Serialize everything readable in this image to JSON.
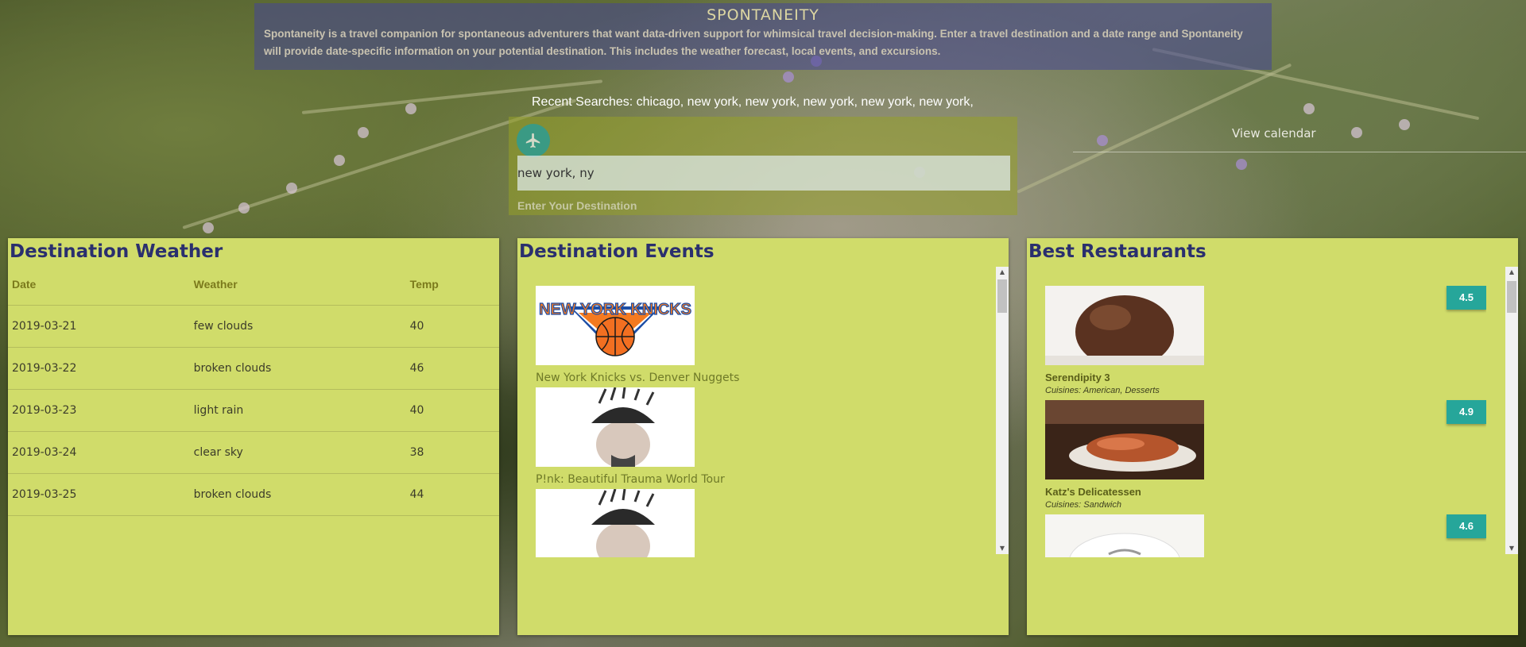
{
  "app": {
    "title": "SPONTANEITY",
    "description": "Spontaneity is a travel companion for spontaneous adventurers that want data-driven support for whimsical travel decision-making. Enter a travel destination and a date range and Spontaneity will provide date-specific information on your potential destination. This includes the weather forecast, local events, and excursions."
  },
  "search": {
    "recent_label": "Recent Searches:",
    "recent_list": "chicago, new york, new york, new york, new york, new york,",
    "input_value": "new york, ny",
    "input_label": "Enter Your Destination",
    "plane_icon": "airplane-icon",
    "view_calendar": "View calendar"
  },
  "weather": {
    "title": "Destination Weather",
    "headers": [
      "Date",
      "Weather",
      "Temp"
    ],
    "rows": [
      [
        "2019-03-21",
        "few clouds",
        "40"
      ],
      [
        "2019-03-22",
        "broken clouds",
        "46"
      ],
      [
        "2019-03-23",
        "light rain",
        "40"
      ],
      [
        "2019-03-24",
        "clear sky",
        "38"
      ],
      [
        "2019-03-25",
        "broken clouds",
        "44"
      ]
    ]
  },
  "events": {
    "title": "Destination Events",
    "items": [
      {
        "name": "New York Knicks vs. Denver Nuggets",
        "logo_text": "NEW YORK KNICKS"
      },
      {
        "name": "P!nk: Beautiful Trauma World Tour"
      },
      {
        "name": ""
      }
    ]
  },
  "restaurants": {
    "title": "Best Restaurants",
    "items": [
      {
        "name": "Serendipity 3",
        "cuisines": "Cuisines: American, Desserts",
        "rating": "4.5"
      },
      {
        "name": "Katz's Delicatessen",
        "cuisines": "Cuisines: Sandwich",
        "rating": "4.9"
      },
      {
        "name": "",
        "cuisines": "",
        "rating": "4.6"
      }
    ]
  },
  "colors": {
    "panel": "#d0dc6a",
    "title": "#2a2f6e",
    "rating": "#26a69a",
    "plane_button": "#3a9a84",
    "header": "#46469680"
  }
}
